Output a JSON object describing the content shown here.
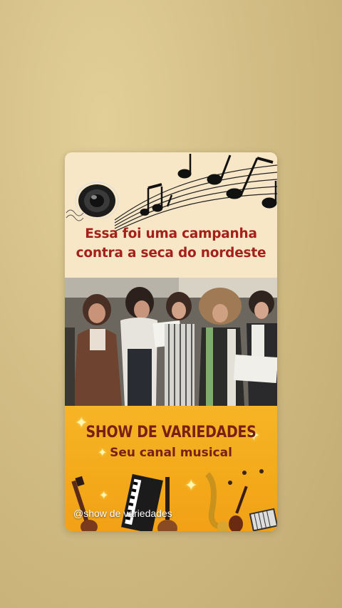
{
  "post": {
    "caption_line1": "Essa foi uma campanha",
    "caption_line2": "contra a seca do nordeste"
  },
  "banner": {
    "title": "SHOW DE VARIEDADES",
    "subtitle": "Seu canal musical",
    "handle": "@show de variedades"
  },
  "colors": {
    "background": "#d2bd85",
    "card_top": "#f8e7c7",
    "caption_red": "#a3211a",
    "banner_orange": "#f3a91a",
    "banner_text": "#7a1f16"
  },
  "icons": [
    "speaker-icon",
    "music-notes-icon",
    "guitar-icon",
    "keyboard-icon",
    "saxophone-icon",
    "violin-icon",
    "sparkle-icon"
  ]
}
